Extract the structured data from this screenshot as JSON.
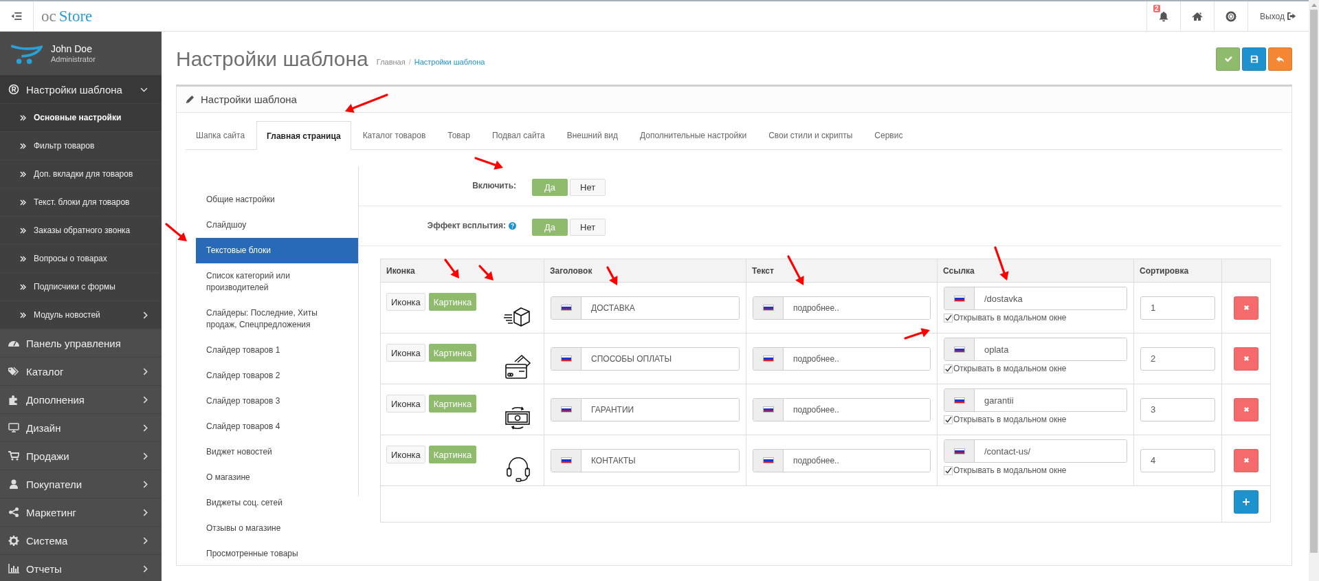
{
  "header": {
    "brand": {
      "prefix": "oc",
      "name": "Store"
    },
    "notifications": "2",
    "logout": "Выход"
  },
  "sidebar": {
    "user": {
      "name": "John Doe",
      "role": "Administrator"
    },
    "items": [
      {
        "label": "Настройки шаблона",
        "kind": "group",
        "expanded": true,
        "children": [
          {
            "label": "Основные настройки",
            "kind": "link",
            "selected": true
          },
          {
            "label": "Фильтр товаров",
            "kind": "link",
            "selected": false
          },
          {
            "label": "Доп. вкладки для товаров",
            "kind": "link",
            "selected": false
          },
          {
            "label": "Текст. блоки для товаров",
            "kind": "link",
            "selected": false
          },
          {
            "label": "Заказы обратного звонка",
            "kind": "link",
            "selected": false
          },
          {
            "label": "Вопросы о товарах",
            "kind": "link",
            "selected": false
          },
          {
            "label": "Подписчики с формы",
            "kind": "link",
            "selected": false
          },
          {
            "label": "Модуль новостей",
            "kind": "group",
            "selected": false
          }
        ]
      },
      {
        "label": "Панель управления",
        "kind": "link"
      },
      {
        "label": "Каталог",
        "kind": "group",
        "expanded": false
      },
      {
        "label": "Дополнения",
        "kind": "group",
        "expanded": false
      },
      {
        "label": "Дизайн",
        "kind": "group",
        "expanded": false
      },
      {
        "label": "Продажи",
        "kind": "group",
        "expanded": false
      },
      {
        "label": "Покупатели",
        "kind": "group",
        "expanded": false
      },
      {
        "label": "Маркетинг",
        "kind": "group",
        "expanded": false
      },
      {
        "label": "Система",
        "kind": "group",
        "expanded": false
      },
      {
        "label": "Отчеты",
        "kind": "group",
        "expanded": false
      }
    ]
  },
  "page": {
    "title": "Настройки шаблона",
    "breadcrumb_separator": "/",
    "breadcrumbs": [
      {
        "label": "Главная",
        "link": false
      },
      {
        "label": "Настройки шаблона",
        "link": true
      }
    ]
  },
  "panel": {
    "title": "Настройки шаблона",
    "tabs": [
      {
        "label": "Шапка сайта",
        "selected": false
      },
      {
        "label": "Главная страница",
        "selected": true
      },
      {
        "label": "Каталог товаров",
        "selected": false
      },
      {
        "label": "Товар",
        "selected": false
      },
      {
        "label": "Подвал сайта",
        "selected": false
      },
      {
        "label": "Внешний вид",
        "selected": false
      },
      {
        "label": "Дополнительные настройки",
        "selected": false
      },
      {
        "label": "Свои стили и скрипты",
        "selected": false
      },
      {
        "label": "Сервис",
        "selected": false
      }
    ],
    "sections": [
      {
        "label": "Общие настройки",
        "selected": false
      },
      {
        "label": "Слайдшоу",
        "selected": false
      },
      {
        "label": "Текстовые блоки",
        "selected": true
      },
      {
        "label": "Список категорий или производителей",
        "selected": false
      },
      {
        "label": "Слайдеры: Последние, Хиты продаж, Спецпредложения",
        "selected": false
      },
      {
        "label": "Слайдер товаров 1",
        "selected": false
      },
      {
        "label": "Слайдер товаров 2",
        "selected": false
      },
      {
        "label": "Слайдер товаров 3",
        "selected": false
      },
      {
        "label": "Слайдер товаров 4",
        "selected": false
      },
      {
        "label": "Виджет новостей",
        "selected": false
      },
      {
        "label": "О магазине",
        "selected": false
      },
      {
        "label": "Виджеты соц. сетей",
        "selected": false
      },
      {
        "label": "Отзывы о магазине",
        "selected": false
      },
      {
        "label": "Просмотренные товары",
        "selected": false
      }
    ],
    "settings": [
      {
        "label": "Включить:",
        "help": false,
        "options": [
          {
            "label": "Да",
            "selected": true
          },
          {
            "label": "Нет",
            "selected": false
          }
        ]
      },
      {
        "label": "Эффект всплытия:",
        "help": true,
        "options": [
          {
            "label": "Да",
            "selected": true
          },
          {
            "label": "Нет",
            "selected": false
          }
        ]
      }
    ],
    "table": {
      "columns": [
        "Иконка",
        "Заголовок",
        "Текст",
        "Ссылка",
        "Сортировка"
      ],
      "rows": [
        {
          "modes": [
            {
              "label": "Иконка",
              "selected": false
            },
            {
              "label": "Картинка",
              "selected": true
            }
          ],
          "title": "ДОСТАВКА",
          "text": "подробнее..",
          "link": "/dostavka",
          "modal": {
            "label": "Открывать в модальном окне",
            "checked": true
          },
          "sort": "1"
        },
        {
          "modes": [
            {
              "label": "Иконка",
              "selected": false
            },
            {
              "label": "Картинка",
              "selected": true
            }
          ],
          "title": "СПОСОБЫ ОПЛАТЫ",
          "text": "подробнее..",
          "link": "oplata",
          "modal": {
            "label": "Открывать в модальном окне",
            "checked": true
          },
          "sort": "2"
        },
        {
          "modes": [
            {
              "label": "Иконка",
              "selected": false
            },
            {
              "label": "Картинка",
              "selected": true
            }
          ],
          "title": "ГАРАНТИИ",
          "text": "подробнее..",
          "link": "garantii",
          "modal": {
            "label": "Открывать в модальном окне",
            "checked": true
          },
          "sort": "3"
        },
        {
          "modes": [
            {
              "label": "Иконка",
              "selected": false
            },
            {
              "label": "Картинка",
              "selected": true
            }
          ],
          "title": "КОНТАКТЫ",
          "text": "подробнее..",
          "link": "/contact-us/",
          "modal": {
            "label": "Открывать в модальном окне",
            "checked": true
          },
          "sort": "4"
        }
      ]
    }
  }
}
